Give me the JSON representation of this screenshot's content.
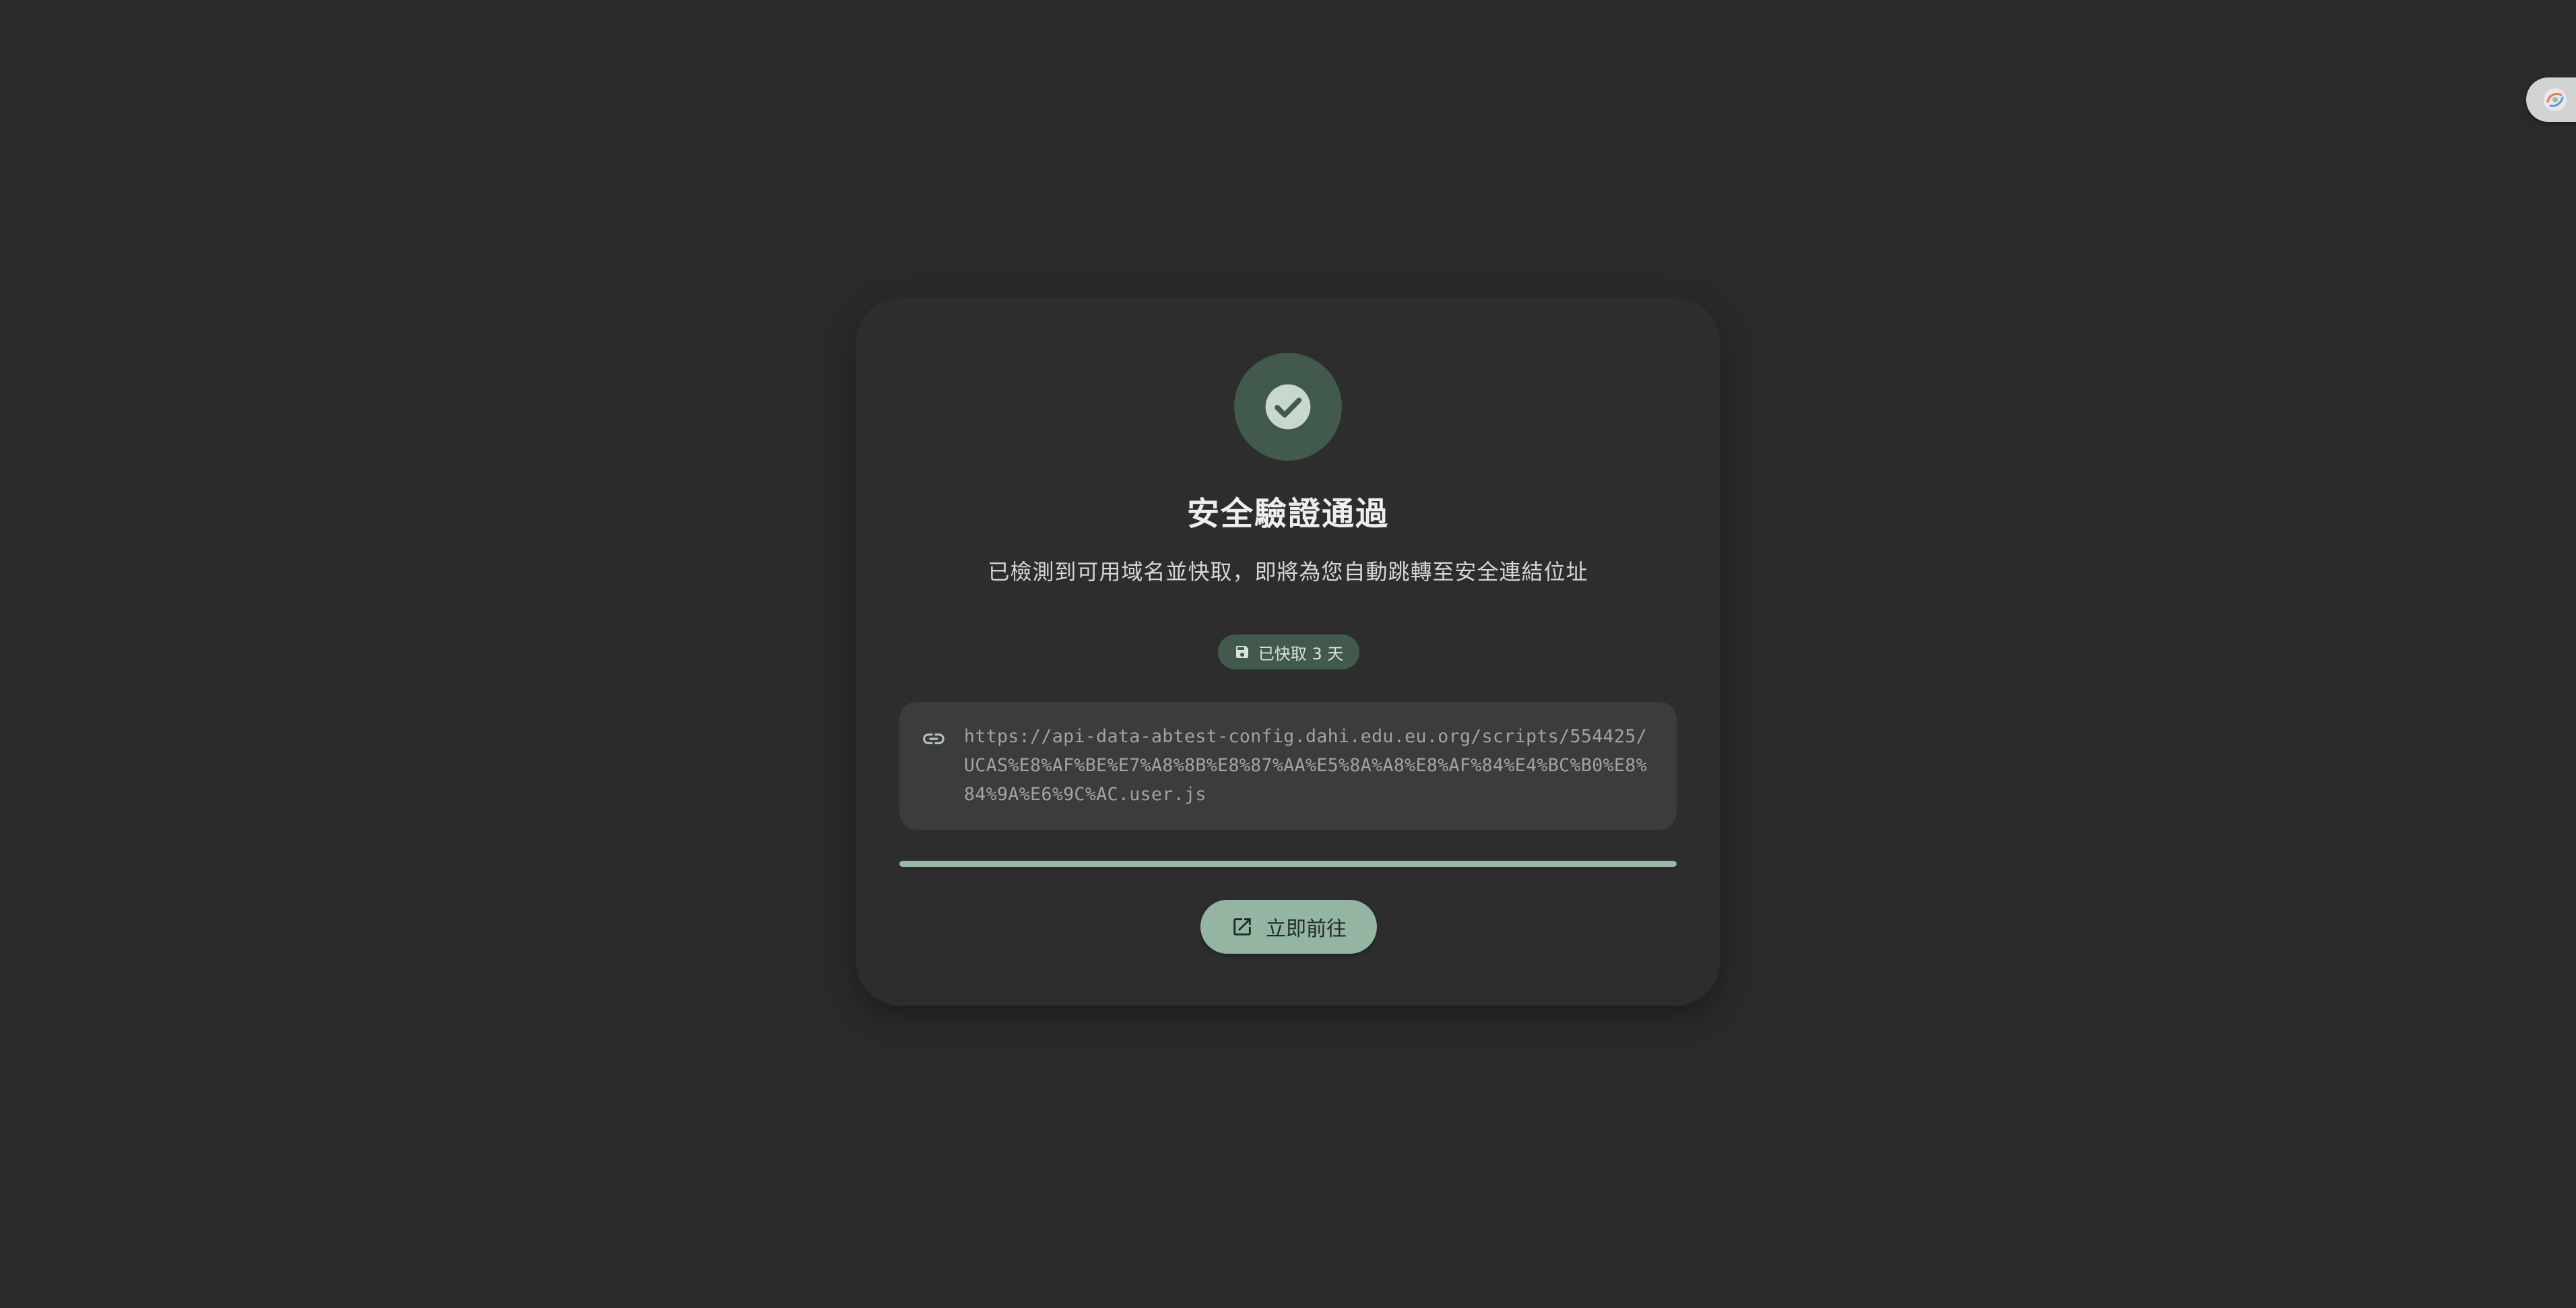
{
  "page": {
    "title": "安全驗證通過",
    "subtitle": "已檢測到可用域名並快取，即將為您自動跳轉至安全連結位址"
  },
  "status": {
    "icon": "check-circle-icon",
    "color": "#42594d"
  },
  "badge": {
    "icon": "save-icon",
    "label": "已快取 3 天"
  },
  "target": {
    "icon": "link-icon",
    "url": "https://api-data-abtest-config.dahi.edu.eu.org/scripts/554425/UCAS%E8%AF%BE%E7%A8%8B%E8%87%AA%E5%8A%A8%E8%AF%84%E4%BC%B0%E8%84%9A%E6%9C%AC.user.js"
  },
  "progress": {
    "fraction": 1.0,
    "color": "#9ab8a6"
  },
  "actions": {
    "go_label": "立即前往",
    "go_icon": "open-in-new-icon"
  },
  "side_widget": {
    "icon": "extension-logo-icon"
  },
  "colors": {
    "background": "#2a2a2a",
    "card": "#2d2d2d",
    "accent": "#95b5a3",
    "accent_dark": "#42594d",
    "url_box": "#3c3c3c"
  }
}
